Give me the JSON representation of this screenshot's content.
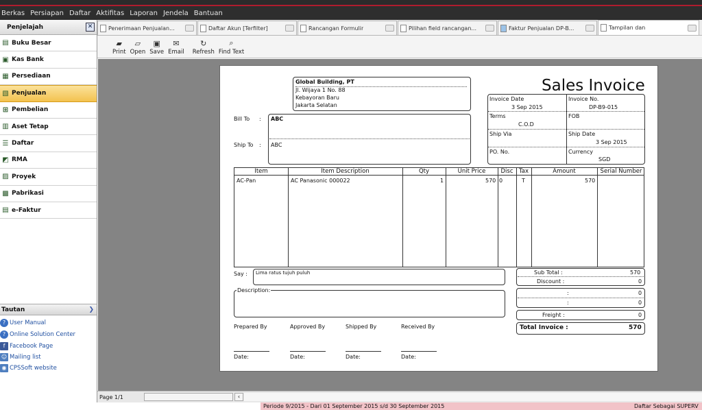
{
  "menu": [
    "Berkas",
    "Persiapan",
    "Daftar",
    "Aktifitas",
    "Laporan",
    "Jendela",
    "Bantuan"
  ],
  "sidebar": {
    "title": "Penjelajah",
    "close_label": "✕",
    "items": [
      {
        "label": "Buku Besar",
        "icon": "ledger-icon",
        "active": false
      },
      {
        "label": "Kas Bank",
        "icon": "bank-icon",
        "active": false
      },
      {
        "label": "Persediaan",
        "icon": "inventory-icon",
        "active": false
      },
      {
        "label": "Penjualan",
        "icon": "sales-icon",
        "active": true
      },
      {
        "label": "Pembelian",
        "icon": "cart-icon",
        "active": false
      },
      {
        "label": "Aset Tetap",
        "icon": "building-icon",
        "active": false
      },
      {
        "label": "Daftar",
        "icon": "list-icon",
        "active": false
      },
      {
        "label": "RMA",
        "icon": "rma-icon",
        "active": false
      },
      {
        "label": "Proyek",
        "icon": "project-icon",
        "active": false
      },
      {
        "label": "Pabrikasi",
        "icon": "factory-icon",
        "active": false
      },
      {
        "label": "e-Faktur",
        "icon": "efaktur-icon",
        "active": false
      }
    ],
    "links_title": "Tautan",
    "links": [
      "User Manual",
      "Online Solution Center",
      "Facebook Page",
      "Mailing list",
      "CPSSoft website"
    ]
  },
  "tabs": [
    {
      "label": "Penerimaan Penjualan...",
      "active": false
    },
    {
      "label": "Daftar Akun [Terfilter]",
      "active": false
    },
    {
      "label": "Rancangan Formulir",
      "active": false
    },
    {
      "label": "Pilihan field rancangan...",
      "active": false
    },
    {
      "label": "Faktur Penjualan DP-B...",
      "active": false
    },
    {
      "label": "Tampilan dan",
      "active": true
    }
  ],
  "toolbar": [
    {
      "label": "Print",
      "icon": "printer-icon"
    },
    {
      "label": "Open",
      "icon": "open-icon"
    },
    {
      "label": "Save",
      "icon": "save-icon"
    },
    {
      "label": "Email",
      "icon": "email-icon"
    },
    {
      "label": "Refresh",
      "icon": "refresh-icon"
    },
    {
      "label": "Find Text",
      "icon": "search-icon"
    }
  ],
  "invoice": {
    "company_name": "Global Building, PT",
    "company_address": [
      "Jl. Wijaya 1 No. 88",
      "Kebayoran Baru",
      "Jakarta Selatan"
    ],
    "title": "Sales Invoice",
    "bill_to_label": "Bill To",
    "bill_to": "ABC",
    "ship_to_label": "Ship To",
    "ship_to": "ABC",
    "invoice_date_label": "Invoice Date",
    "invoice_date": "3 Sep 2015",
    "invoice_no_label": "Invoice No.",
    "invoice_no": "DP-B9-015",
    "terms_label": "Terms",
    "terms": "C.O.D",
    "fob_label": "FOB",
    "fob": "",
    "ship_via_label": "Ship Via",
    "ship_via": "",
    "ship_date_label": "Ship Date",
    "ship_date": "3 Sep 2015",
    "po_label": "PO. No.",
    "po": "",
    "currency_label": "Currency",
    "currency": "SGD",
    "columns": [
      "Item",
      "Item Description",
      "Qty",
      "Unit Price",
      "Disc",
      "Tax",
      "Amount",
      "Serial Number"
    ],
    "rows": [
      {
        "item": "AC-Pan",
        "description": "AC Panasonic 000022",
        "qty": "1",
        "unit_price": "570",
        "disc": "0",
        "tax": "T",
        "amount": "570",
        "serial": ""
      }
    ],
    "say_label": "Say :",
    "say": "Lima ratus tujuh puluh",
    "description_label": "Description:",
    "totals": [
      {
        "label": "Sub Total :",
        "value": "570"
      },
      {
        "label": "Discount :",
        "value": "0"
      },
      {
        "label": ":",
        "value": "0"
      },
      {
        "label": ":",
        "value": "0"
      },
      {
        "label": "Freight :",
        "value": "0"
      }
    ],
    "total_label": "Total Invoice :",
    "total_value": "570",
    "signatures": [
      "Prepared By",
      "Approved By",
      "Shipped By",
      "Received By"
    ],
    "date_label": "Date:"
  },
  "status": {
    "page": "Page 1/1",
    "period": "Periode 9/2015 - Dari 01 September 2015 s/d 30 September 2015",
    "user": "Daftar Sebagai SUPERV"
  },
  "colors": {
    "accent": "#b01c2e",
    "workspace": "#848484",
    "active_nav": "#f3c24f"
  }
}
